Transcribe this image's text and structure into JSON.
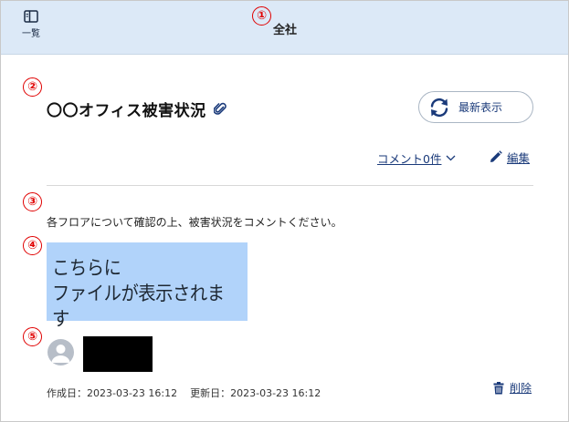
{
  "header": {
    "list_label": "一覧",
    "title": "全社"
  },
  "markers": [
    "①",
    "②",
    "③",
    "④",
    "⑤"
  ],
  "post": {
    "title": "〇〇オフィス被害状況",
    "refresh_label": "最新表示",
    "comments_label": "コメント0件",
    "edit_label": "編集",
    "description": "各フロアについて確認の上、被害状況をコメントください。",
    "file_placeholder": [
      "こちらに",
      "ファイルが表示されます"
    ],
    "created_label": "作成日：2023-03-23 16:12",
    "updated_label": "更新日：2023-03-23 16:12",
    "delete_label": "削除"
  },
  "colors": {
    "header_bg": "#dce9f7",
    "link": "#1a3a7a",
    "marker": "#e00000",
    "file_bg": "#b1d3fa"
  },
  "icons": [
    "sidebar-panel-icon",
    "paperclip-icon",
    "refresh-icon",
    "chevron-down-icon",
    "pencil-icon",
    "user-avatar-icon",
    "trash-icon"
  ]
}
